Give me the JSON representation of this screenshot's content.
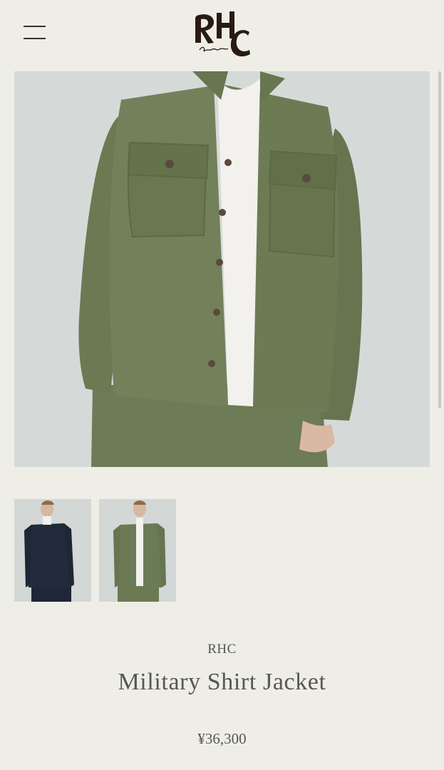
{
  "header": {
    "logo_text": "RHC",
    "logo_signature": "Ron Herman",
    "menu_icon": "hamburger-menu-icon"
  },
  "product": {
    "brand": "RHC",
    "name": "Military Shirt Jacket",
    "price": "¥36,300",
    "selected_color": "#6b7b55",
    "thumbnails": [
      {
        "icon": "navy-jacket-model-photo",
        "color": "#222b3c"
      },
      {
        "icon": "olive-jacket-model-photo",
        "color": "#6b7b55"
      }
    ]
  }
}
